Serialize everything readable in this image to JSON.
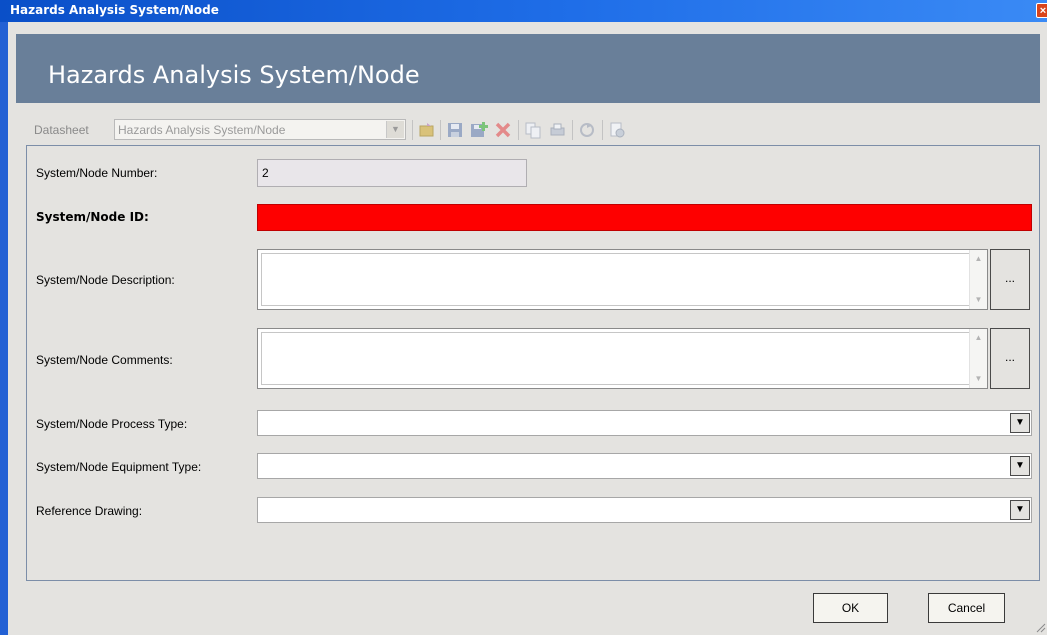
{
  "window": {
    "title": "Hazards Analysis System/Node",
    "close_glyph": "×"
  },
  "header": {
    "title": "Hazards Analysis System/Node"
  },
  "toolbar": {
    "datasheet_label": "Datasheet",
    "datasheet_value": "Hazards Analysis System/Node",
    "icons": [
      "open-icon",
      "save-icon",
      "save-new-icon",
      "delete-icon",
      "copy-icon",
      "print-icon",
      "refresh-icon",
      "report-icon"
    ]
  },
  "form": {
    "number": {
      "label": "System/Node Number:",
      "value": "2"
    },
    "id": {
      "label": "System/Node ID:",
      "value": "",
      "required_color": "#fe0000"
    },
    "description": {
      "label": "System/Node Description:",
      "value": "",
      "button": "..."
    },
    "comments": {
      "label": "System/Node Comments:",
      "value": "",
      "button": "..."
    },
    "process_type": {
      "label": "System/Node Process Type:",
      "value": ""
    },
    "equipment_type": {
      "label": "System/Node Equipment Type:",
      "value": ""
    },
    "reference_drawing": {
      "label": "Reference Drawing:",
      "value": ""
    }
  },
  "buttons": {
    "ok": "OK",
    "cancel": "Cancel"
  },
  "colors": {
    "title_bar": "#1f6ee8",
    "header_band": "#697f99",
    "client": "#e4e3e0",
    "required": "#fe0000"
  }
}
